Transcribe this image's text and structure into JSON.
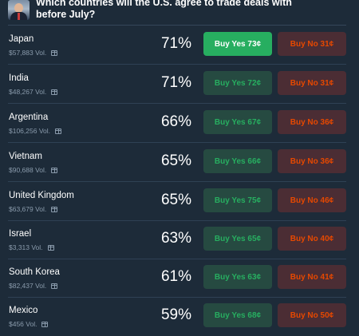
{
  "market": {
    "title": "Which countries will the U.S. agree to trade deals with before July?"
  },
  "outcomes": [
    {
      "country": "Japan",
      "volume": "$57,883 Vol.",
      "percent": "71%",
      "yes": "Buy Yes 73¢",
      "no": "Buy No 31¢"
    },
    {
      "country": "India",
      "volume": "$48,267 Vol.",
      "percent": "71%",
      "yes": "Buy Yes 72¢",
      "no": "Buy No 31¢"
    },
    {
      "country": "Argentina",
      "volume": "$106,256 Vol.",
      "percent": "66%",
      "yes": "Buy Yes 67¢",
      "no": "Buy No 36¢"
    },
    {
      "country": "Vietnam",
      "volume": "$90,688 Vol.",
      "percent": "65%",
      "yes": "Buy Yes 66¢",
      "no": "Buy No 36¢"
    },
    {
      "country": "United Kingdom",
      "volume": "$63,679 Vol.",
      "percent": "65%",
      "yes": "Buy Yes 75¢",
      "no": "Buy No 46¢"
    },
    {
      "country": "Israel",
      "volume": "$3,313 Vol.",
      "percent": "63%",
      "yes": "Buy Yes 65¢",
      "no": "Buy No 40¢"
    },
    {
      "country": "South Korea",
      "volume": "$82,437 Vol.",
      "percent": "61%",
      "yes": "Buy Yes 63¢",
      "no": "Buy No 41¢"
    },
    {
      "country": "Mexico",
      "volume": "$456 Vol.",
      "percent": "59%",
      "yes": "Buy Yes 68¢",
      "no": "Buy No 50¢"
    }
  ],
  "colors": {
    "background": "#1d2b39",
    "yes_accent": "#27ae60",
    "no_accent": "#e64800"
  },
  "icons": {
    "volume_icon": "gift-icon"
  }
}
